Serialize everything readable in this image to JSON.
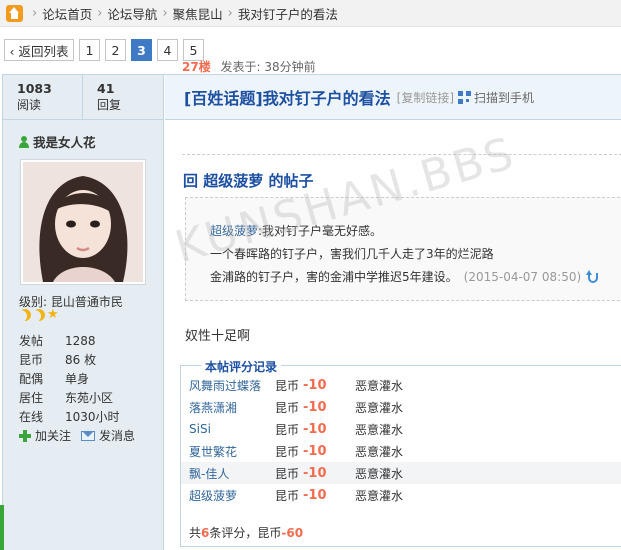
{
  "breadcrumb": {
    "items": [
      "论坛首页",
      "论坛导航",
      "聚焦昆山",
      "我对钉子户的看法"
    ],
    "separator": "›"
  },
  "pager": {
    "back_label": "‹ 返回列表",
    "pages": [
      "1",
      "2",
      "3",
      "4",
      "5"
    ],
    "current": "3"
  },
  "stats": {
    "views": "1083",
    "views_label": "阅读",
    "replies": "41",
    "replies_label": "回复"
  },
  "thread": {
    "title": "[百姓话题]我对钉子户的看法",
    "copy_link": "[复制链接]",
    "scan_label": "扫描到手机"
  },
  "user": {
    "name": "我是女人花",
    "level": "级别: 昆山普通市民",
    "info": [
      {
        "k": "发帖",
        "v": "1288"
      },
      {
        "k": "昆币",
        "v": "86 枚"
      },
      {
        "k": "配偶",
        "v": "单身"
      },
      {
        "k": "居住",
        "v": "东苑小区"
      },
      {
        "k": "在线",
        "v": "1030小时"
      }
    ],
    "follow_label": "加关注",
    "message_label": "发消息"
  },
  "post": {
    "floor": "27楼",
    "posted": "发表于: 38分钟前",
    "reply_title": "回 超级菠萝 的帖子",
    "quote": {
      "user": "超级菠萝",
      "line1": ":我对钉子户毫无好感。",
      "line2": "一个春晖路的钉子户，害我们几千人走了3年的烂泥路",
      "line3": "金浦路的钉子户，害的金浦中学推迟5年建设。",
      "time": "(2015-04-07 08:50)"
    },
    "body": "奴性十足啊"
  },
  "rating": {
    "legend": "本帖评分记录",
    "rows": [
      {
        "user": "风舞雨过蝶落",
        "currency": "昆币",
        "value": "-10",
        "reason": "恶意灌水"
      },
      {
        "user": "落燕潇湘",
        "currency": "昆币",
        "value": "-10",
        "reason": "恶意灌水"
      },
      {
        "user": "SiSi",
        "currency": "昆币",
        "value": "-10",
        "reason": "恶意灌水"
      },
      {
        "user": "夏世繁花",
        "currency": "昆币",
        "value": "-10",
        "reason": "恶意灌水"
      },
      {
        "user": "飘-佳人",
        "currency": "昆币",
        "value": "-10",
        "reason": "恶意灌水"
      },
      {
        "user": "超级菠萝",
        "currency": "昆币",
        "value": "-10",
        "reason": "恶意灌水"
      }
    ],
    "summary_prefix": "共",
    "summary_count": "6",
    "summary_mid": "条评分，昆币",
    "summary_total": "-60"
  },
  "watermark": "KUNSHAN.BBS"
}
